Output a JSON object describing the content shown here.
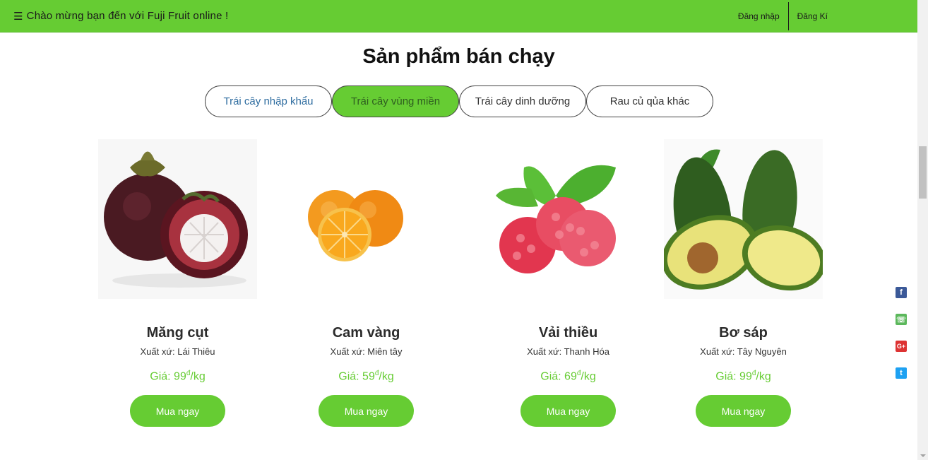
{
  "topbar": {
    "menu_icon": "menu-icon",
    "welcome": "Chào mừng bạn đến với Fuji Fruit online !",
    "login": "Đăng nhập",
    "register": "Đăng Kí"
  },
  "section": {
    "title": "Sản phẩm bán chạy"
  },
  "tabs": [
    {
      "label": "Trái cây nhập khẩu"
    },
    {
      "label": "Trái cây vùng miền",
      "active": true
    },
    {
      "label": "Trái cây dinh dưỡng"
    },
    {
      "label": "Rau củ qủa khác"
    }
  ],
  "products": [
    {
      "name": "Măng cụt",
      "origin": "Xuất xứ: Lái Thiêu",
      "price_prefix": "Giá: 99",
      "currency": "đ",
      "unit": "/kg",
      "button": "Mua ngay",
      "image": "mangosteen-image"
    },
    {
      "name": "Cam vàng",
      "origin": "Xuất xứ: Miên tây",
      "price_prefix": "Giá: 59",
      "currency": "đ",
      "unit": "/kg",
      "button": "Mua ngay",
      "image": "orange-image"
    },
    {
      "name": "Vải thiều",
      "origin": "Xuất xứ: Thanh Hóa",
      "price_prefix": "Giá: 69",
      "currency": "đ",
      "unit": "/kg",
      "button": "Mua ngay",
      "image": "raspberry-image"
    },
    {
      "name": "Bơ sáp",
      "origin": "Xuất xứ: Tây Nguyên",
      "price_prefix": "Giá: 99",
      "currency": "đ",
      "unit": "/kg",
      "button": "Mua ngay",
      "image": "avocado-image"
    }
  ],
  "social": {
    "facebook": "f",
    "phone": "☏",
    "google_plus": "G+",
    "twitter": "t"
  },
  "colors": {
    "brand_green": "#66cc33"
  }
}
